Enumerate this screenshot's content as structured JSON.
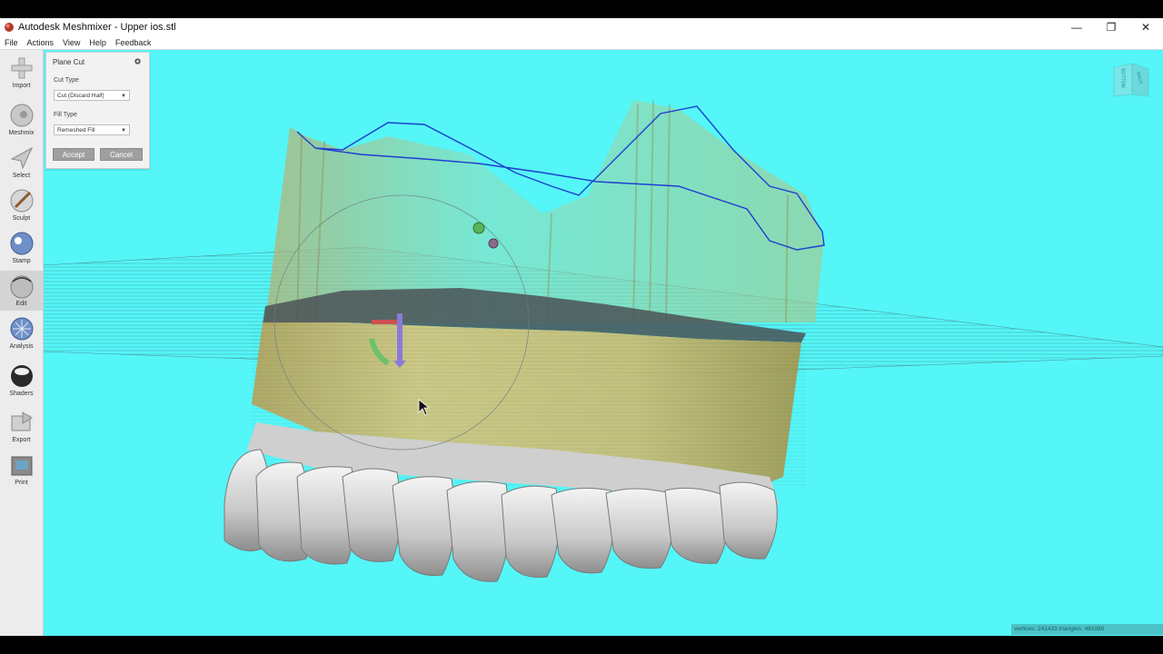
{
  "window": {
    "title": "Autodesk Meshmixer - Upper ios.stl",
    "controls": {
      "minimize": "—",
      "restore": "❐",
      "close": "✕"
    }
  },
  "menu": {
    "items": [
      {
        "label": "File"
      },
      {
        "label": "Actions"
      },
      {
        "label": "View"
      },
      {
        "label": "Help"
      },
      {
        "label": "Feedback"
      }
    ]
  },
  "toolbar": {
    "items": [
      {
        "label": "Import",
        "icon": "import-icon"
      },
      {
        "label": "Meshmix",
        "icon": "meshmix-icon"
      },
      {
        "label": "Select",
        "icon": "select-icon"
      },
      {
        "label": "Sculpt",
        "icon": "sculpt-icon"
      },
      {
        "label": "Stamp",
        "icon": "stamp-icon"
      },
      {
        "label": "Edit",
        "icon": "edit-icon",
        "active": true
      },
      {
        "label": "Analysis",
        "icon": "analysis-icon"
      },
      {
        "label": "Shaders",
        "icon": "shaders-icon"
      },
      {
        "label": "Export",
        "icon": "export-icon"
      },
      {
        "label": "Print",
        "icon": "print-icon"
      }
    ]
  },
  "panel": {
    "title": "Plane Cut",
    "cut_type_label": "Cut Type",
    "cut_type_value": "Cut (Discard Half)",
    "fill_type_label": "Fill Type",
    "fill_type_value": "Remeshed Fill",
    "accept_label": "Accept",
    "cancel_label": "Cancel"
  },
  "navcube": {
    "face_left": "BOTTOM",
    "face_right": "BACK"
  },
  "status": {
    "text": "vertices: 241433 triangles: 481080"
  },
  "colors": {
    "viewport_bg": "#55f6f8",
    "mesh_upper": "#c9b46a",
    "teeth": "#d8d8d8",
    "outline": "#2040c0"
  }
}
